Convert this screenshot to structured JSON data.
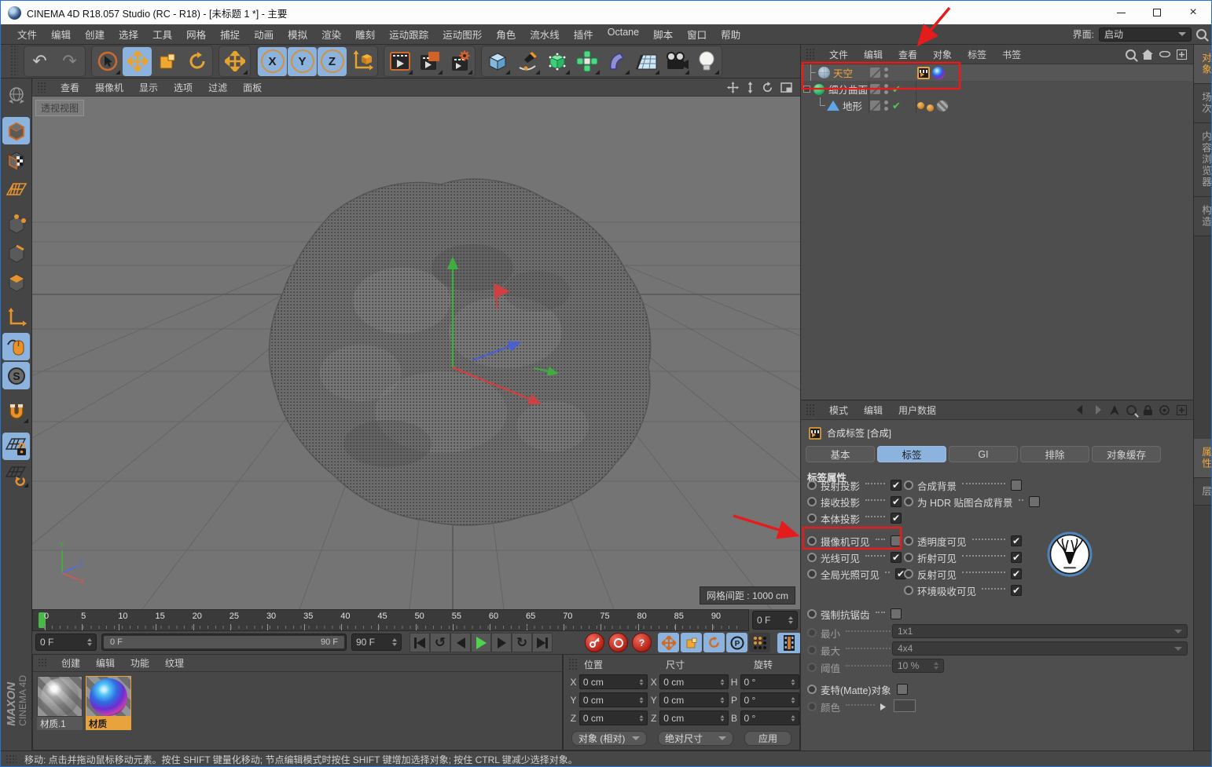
{
  "window": {
    "title": "CINEMA 4D R18.057 Studio (RC - R18) - [未标题 1 *] - 主要"
  },
  "icons": {
    "undo": "↶",
    "redo": "↷",
    "check": "✔",
    "loop_back": "↺",
    "loop_fwd": "↻",
    "question": "?",
    "close": "×"
  },
  "menu_bar": {
    "items": [
      "文件",
      "编辑",
      "创建",
      "选择",
      "工具",
      "网格",
      "捕捉",
      "动画",
      "模拟",
      "渲染",
      "雕刻",
      "运动跟踪",
      "运动图形",
      "角色",
      "流水线",
      "插件",
      "Octane",
      "脚本",
      "窗口",
      "帮助"
    ],
    "interface_label": "界面:",
    "interface_value": "启动"
  },
  "toolbar": {
    "axis_buttons": [
      "X",
      "Y",
      "Z"
    ]
  },
  "viewport": {
    "menu": [
      "查看",
      "摄像机",
      "显示",
      "选项",
      "过滤",
      "面板"
    ],
    "view_label": "透视视图",
    "grid_spacing": "网格间距 : 1000 cm",
    "axis_x": "X",
    "axis_y": "Y",
    "axis_z": "Z"
  },
  "object_manager": {
    "menu": [
      "文件",
      "编辑",
      "查看",
      "对象",
      "标签",
      "书签"
    ],
    "objects": [
      {
        "name": "天空"
      },
      {
        "name": "细分曲面"
      },
      {
        "name": "地形"
      }
    ]
  },
  "right_tabs": {
    "top": [
      {
        "label": "对象",
        "active": true
      },
      {
        "label": "场次"
      },
      {
        "label": "内容浏览器"
      },
      {
        "label": "构造"
      }
    ],
    "bottom": [
      {
        "label": "属性",
        "active": true
      },
      {
        "label": "层"
      }
    ]
  },
  "attribute_manager": {
    "menu": [
      "模式",
      "编辑",
      "用户数据"
    ],
    "title": "合成标签 [合成]",
    "tabs": [
      {
        "label": "基本"
      },
      {
        "label": "标签",
        "active": true
      },
      {
        "label": "GI"
      },
      {
        "label": "排除"
      },
      {
        "label": "对象缓存"
      }
    ],
    "section": "标签属性",
    "col1": [
      {
        "label": "投射投影",
        "checked": true
      },
      {
        "label": "接收投影",
        "checked": true
      },
      {
        "label": "本体投影",
        "checked": true
      },
      {
        "label": "摄像机可见",
        "checked": false
      },
      {
        "label": "光线可见",
        "checked": true
      },
      {
        "label": "全局光照可见",
        "checked": true
      }
    ],
    "col2": [
      {
        "label": "合成背景",
        "checked": false
      },
      {
        "label": "为 HDR 贴图合成背景",
        "checked": false
      },
      {
        "label": "透明度可见",
        "checked": true
      },
      {
        "label": "折射可见",
        "checked": true
      },
      {
        "label": "反射可见",
        "checked": true
      },
      {
        "label": "环境吸收可见",
        "checked": true
      }
    ],
    "extra": {
      "force_aa": {
        "label": "强制抗锯齿",
        "checked": false
      },
      "min": {
        "label": "最小",
        "value": "1x1"
      },
      "max": {
        "label": "最大",
        "value": "4x4"
      },
      "threshold": {
        "label": "阈值",
        "value": "10 %"
      },
      "matte": {
        "label": "麦特(Matte)对象",
        "checked": false
      },
      "color": {
        "label": "颜色"
      }
    }
  },
  "timeline": {
    "ticks": [
      "0",
      "5",
      "10",
      "15",
      "20",
      "25",
      "30",
      "35",
      "40",
      "45",
      "50",
      "55",
      "60",
      "65",
      "70",
      "75",
      "80",
      "85",
      "90"
    ],
    "frame_spin": "0 F",
    "current": "0 F",
    "range_start": "0 F",
    "range_end": "90 F",
    "end": "90 F"
  },
  "materials": {
    "menu": [
      "创建",
      "编辑",
      "功能",
      "纹理"
    ],
    "items": [
      {
        "name": "材质.1"
      },
      {
        "name": "材质",
        "selected": true
      }
    ]
  },
  "coordinates": {
    "headers": [
      "位置",
      "尺寸",
      "旋转"
    ],
    "pos": {
      "labels": [
        "X",
        "Y",
        "Z"
      ],
      "values": [
        "0 cm",
        "0 cm",
        "0 cm"
      ]
    },
    "size": {
      "labels": [
        "X",
        "Y",
        "Z"
      ],
      "values": [
        "0 cm",
        "0 cm",
        "0 cm"
      ]
    },
    "rot": {
      "labels": [
        "H",
        "P",
        "B"
      ],
      "values": [
        "0 °",
        "0 °",
        "0 °"
      ]
    },
    "footer": {
      "mode": "对象 (相对)",
      "size_mode": "绝对尺寸",
      "apply": "应用"
    }
  },
  "brand": {
    "line1": "MAXON",
    "line2": "CINEMA 4D"
  },
  "status_bar": {
    "text": "移动: 点击并拖动鼠标移动元素。按住 SHIFT 键量化移动; 节点编辑模式时按住 SHIFT 键增加选择对象; 按住 CTRL 键减少选择对象。"
  }
}
